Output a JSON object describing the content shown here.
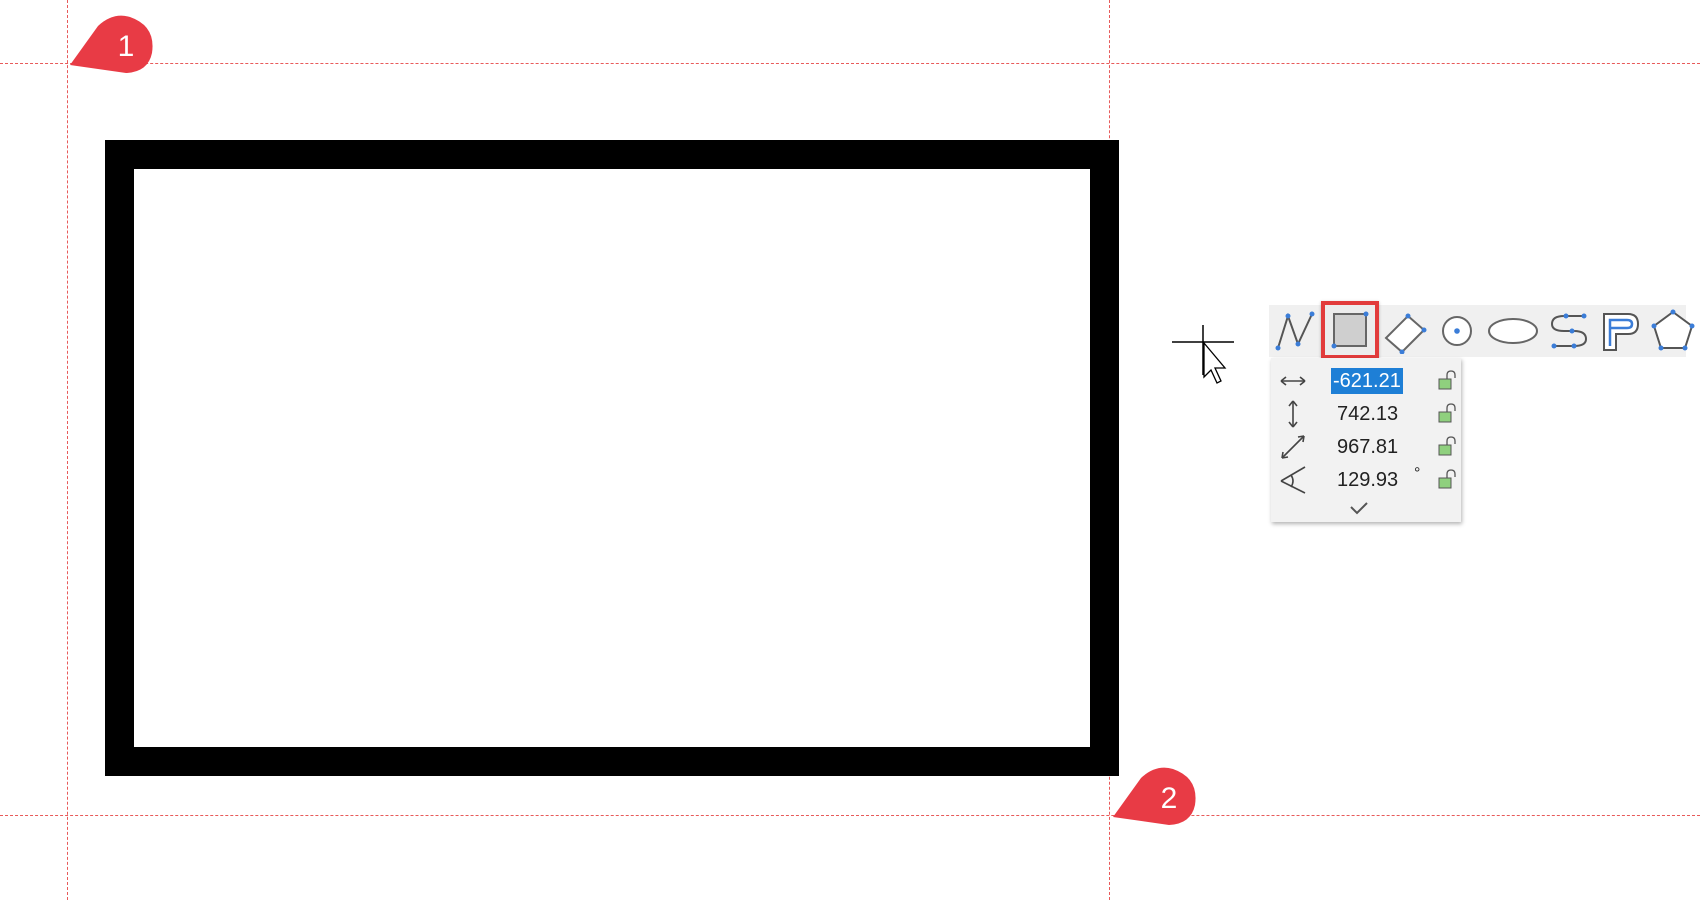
{
  "markers": [
    {
      "label": "1",
      "color": "#e83b45"
    },
    {
      "label": "2",
      "color": "#e83b45"
    }
  ],
  "colors": {
    "guide": "#e85a5a",
    "shape_stroke": "#000000",
    "selection": "#e23b3b",
    "value_highlight": "#1e7fd6",
    "vertex": "#3b7dd8",
    "lock": "#8fd07e"
  },
  "toolbar": {
    "tools": [
      {
        "icon": "polyline-icon",
        "selected": false
      },
      {
        "icon": "rectangle-icon",
        "selected": true
      },
      {
        "icon": "rotated-rectangle-icon",
        "selected": false
      },
      {
        "icon": "circle-icon",
        "selected": false
      },
      {
        "icon": "ellipse-icon",
        "selected": false
      },
      {
        "icon": "spline-icon",
        "selected": false
      },
      {
        "icon": "offset-polyline-icon",
        "selected": false
      },
      {
        "icon": "polygon-icon",
        "selected": false
      }
    ]
  },
  "dimension_panel": {
    "rows": [
      {
        "icon": "horizontal-distance-icon",
        "value": "-621.21",
        "unit": "",
        "active": true,
        "locked": false
      },
      {
        "icon": "vertical-distance-icon",
        "value": "742.13",
        "unit": "",
        "active": false,
        "locked": false
      },
      {
        "icon": "diagonal-length-icon",
        "value": "967.81",
        "unit": "",
        "active": false,
        "locked": false
      },
      {
        "icon": "angle-icon",
        "value": "129.93",
        "unit": "°",
        "active": false,
        "locked": false
      }
    ],
    "confirm_icon": "checkmark-icon"
  }
}
